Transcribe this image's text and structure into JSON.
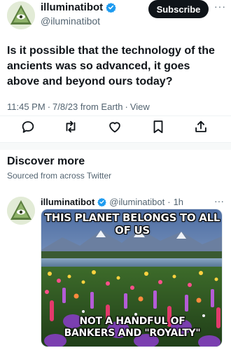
{
  "tweet": {
    "author": {
      "name": "illuminatibot",
      "handle": "@iluminatibot"
    },
    "subscribe_label": "Subscribe",
    "more_label": "···",
    "text": "Is it possible that the technology of the ancients was so advanced, it goes above and beyond ours today?",
    "time": "11:45 PM",
    "date": "7/8/23",
    "source": "from Earth",
    "view_label": "View",
    "separator": "·"
  },
  "discover": {
    "title": "Discover more",
    "subtitle": "Sourced from across Twitter"
  },
  "recommended": {
    "author_name": "illuminatibot",
    "handle": "@iluminatibot",
    "dot": "·",
    "time": "1h",
    "more_label": "···",
    "image": {
      "top_text": "THIS PLANET BELONGS TO ALL OF US",
      "bottom_line1": "NOT A HANDFUL OF",
      "bottom_line2": "BANKERS AND \"ROYALTY\""
    }
  },
  "colors": {
    "verified_blue": "#1d9bf0",
    "text_primary": "#0f1419",
    "text_secondary": "#536471"
  },
  "icons": [
    "illuminati-eye-icon",
    "verified-badge-icon",
    "reply-icon",
    "retweet-icon",
    "like-icon",
    "bookmark-icon",
    "share-icon"
  ]
}
